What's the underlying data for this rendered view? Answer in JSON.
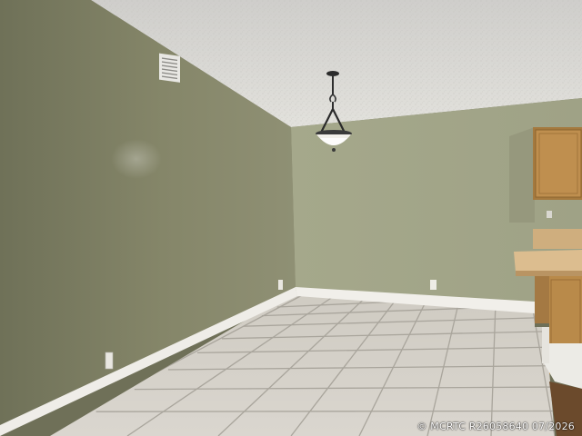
{
  "photo": {
    "subject": "empty room with tiled floor, pendant light and kitchen counter",
    "watermark": "© MCRTC R26058640 07/2026",
    "colors": {
      "left_wall": "#83836a",
      "back_wall": "#a6a88a",
      "ceiling": "#d8d7d2",
      "floor": "#d7d3cb",
      "grout": "#a9a59c",
      "baseboard": "#f1efea",
      "cabinet": "#b98a4a",
      "counter_top": "#d8b98c"
    }
  }
}
